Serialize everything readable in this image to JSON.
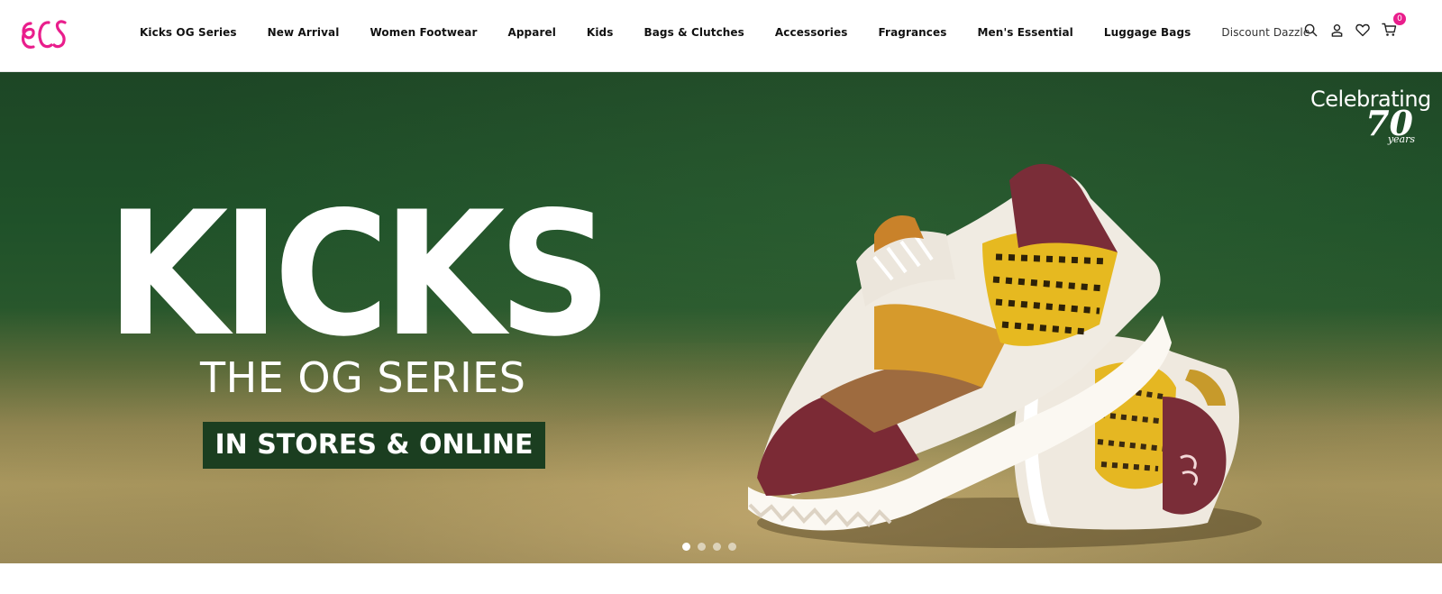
{
  "brand": {
    "logo_text": "ecs",
    "accent_color": "#e91e8c"
  },
  "nav": {
    "items": [
      {
        "label": "Kicks OG Series"
      },
      {
        "label": "New Arrival"
      },
      {
        "label": "Women Footwear"
      },
      {
        "label": "Apparel"
      },
      {
        "label": "Kids"
      },
      {
        "label": "Bags & Clutches"
      },
      {
        "label": "Accessories"
      },
      {
        "label": "Fragrances"
      },
      {
        "label": "Men's Essential"
      },
      {
        "label": "Luggage Bags"
      },
      {
        "label": "Discount Dazzle"
      }
    ]
  },
  "header_icons": {
    "search": "search-icon",
    "account": "user-icon",
    "wishlist": "heart-icon",
    "cart": "cart-icon",
    "cart_count": "0"
  },
  "banner": {
    "headline": "KICKS",
    "subheadline": "THE OG SERIES",
    "cta": "IN STORES & ONLINE",
    "celebrating": "Celebrating",
    "years_number": "70",
    "years_label": "years",
    "background_color": "#1f5129",
    "cta_color": "#1b3e20"
  },
  "carousel": {
    "slide_count": 4,
    "active_index": 0
  }
}
